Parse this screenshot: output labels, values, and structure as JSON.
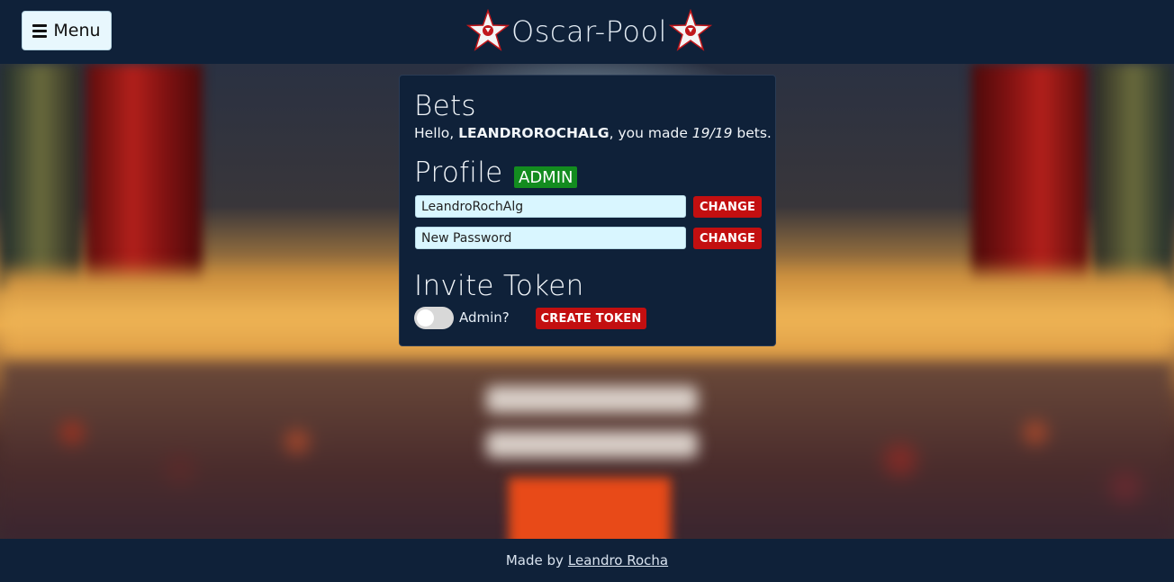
{
  "header": {
    "menu_label": "Menu",
    "brand_title": "Oscar-Pool",
    "menu_icon": "hamburger-icon",
    "brand_icon": "star-icon"
  },
  "bets": {
    "heading": "Bets",
    "greeting_prefix": "Hello, ",
    "username": "LEANDROROCHALG",
    "greeting_middle": ", you made ",
    "bet_count": "19/19",
    "greeting_suffix": " bets."
  },
  "profile": {
    "heading": "Profile",
    "role_badge": "ADMIN",
    "username_value": "LeandroRochAlg",
    "password_placeholder": "New Password",
    "change_label": "CHANGE"
  },
  "invite": {
    "heading": "Invite Token",
    "admin_toggle_label": "Admin?",
    "admin_toggle_on": false,
    "create_label": "CREATE TOKEN"
  },
  "footer": {
    "made_by": "Made by",
    "author_link": "Leandro Rocha"
  },
  "colors": {
    "navy": "#0f2139",
    "danger": "#c30f10",
    "success": "#138c1f",
    "field_bg": "#d9f6ff"
  }
}
